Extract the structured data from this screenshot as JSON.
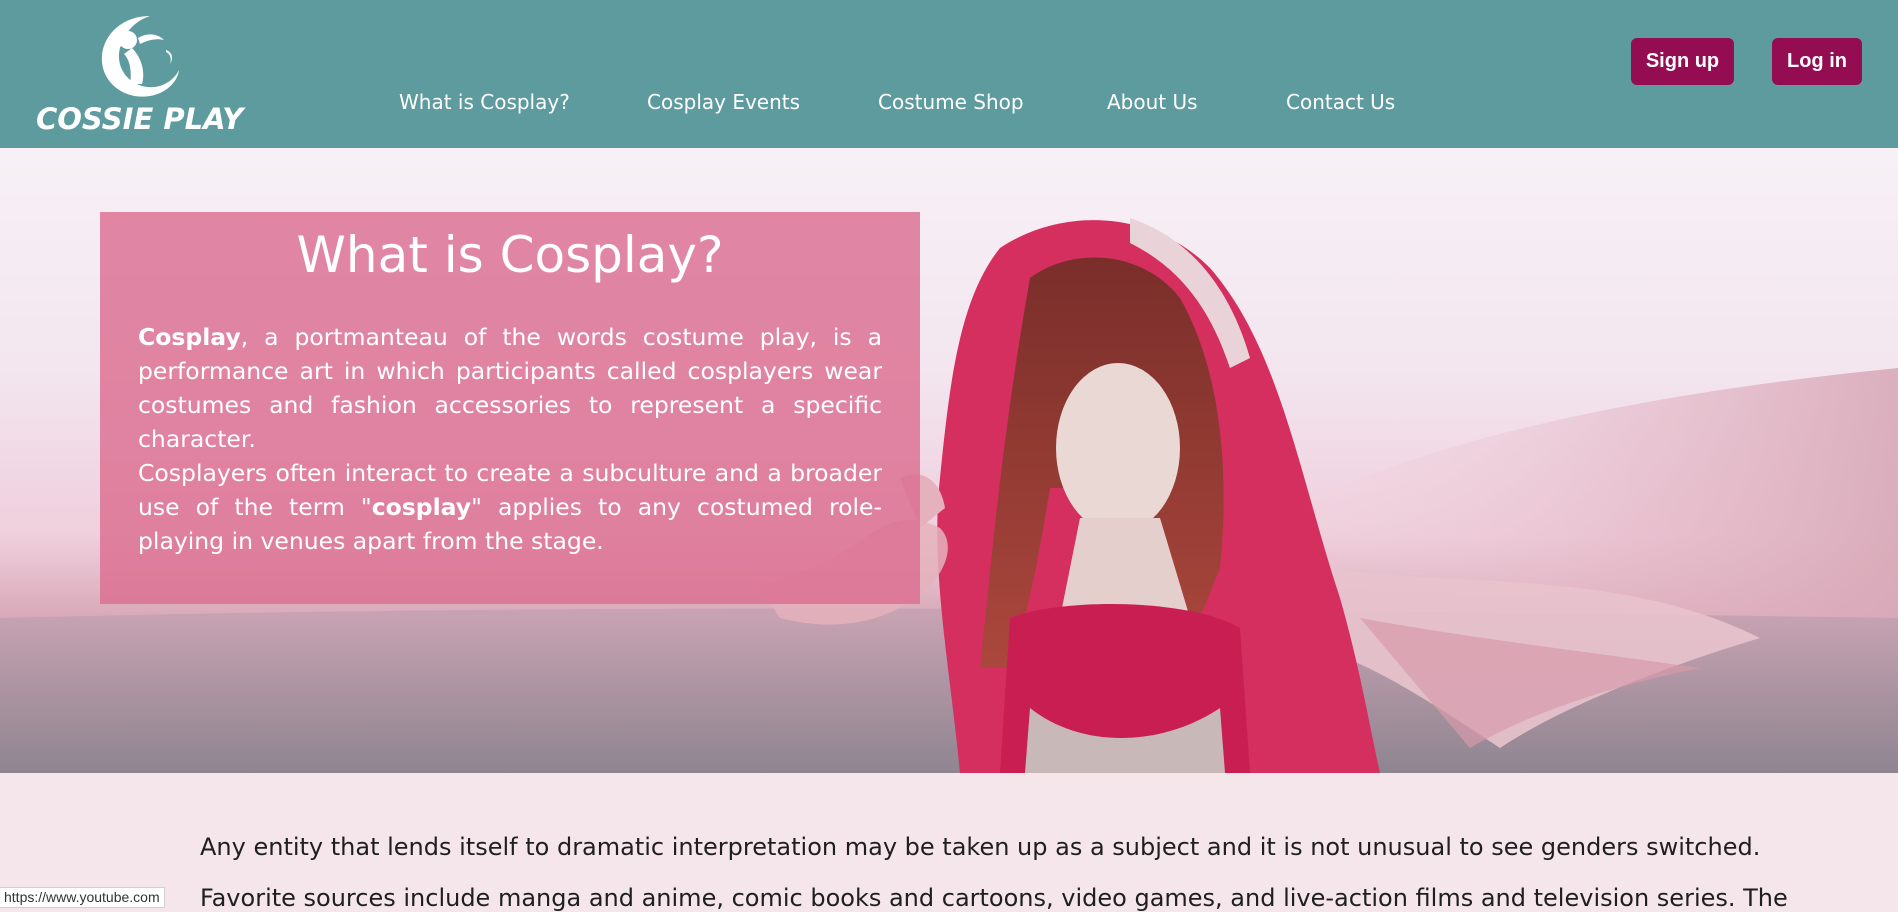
{
  "header": {
    "logo_text": "COSSIE PLAY",
    "nav": [
      {
        "label": "What is Cosplay?"
      },
      {
        "label": "Cosplay Events"
      },
      {
        "label": "Costume Shop"
      },
      {
        "label": "About Us"
      },
      {
        "label": "Contact Us"
      }
    ],
    "signup_label": "Sign up",
    "login_label": "Log in"
  },
  "hero": {
    "title": "What is Cosplay?",
    "p1_bold": "Cosplay",
    "p1_rest": ", a portmanteau of the words costume play, is a performance art in which participants called cosplayers wear costumes and fashion accessories to represent a specific character.",
    "p2_before": "Cosplayers often interact to create a subculture and a broader use of the term \"",
    "p2_bold": "cosplay",
    "p2_after": "\" applies to any costumed role-playing in venues apart from the stage."
  },
  "content": {
    "line1": "Any entity that lends itself to dramatic interpretation may be taken up as a subject and it is not unusual to see genders switched.",
    "line2": "Favorite sources include manga and anime, comic books and cartoons, video games, and live-action films and television series. The"
  },
  "status_url": "https://www.youtube.com",
  "colors": {
    "header_bg": "#5e9b9e",
    "button_bg": "#940d52",
    "hero_card": "#dc6e91",
    "page_bg": "#f5e6ec"
  }
}
